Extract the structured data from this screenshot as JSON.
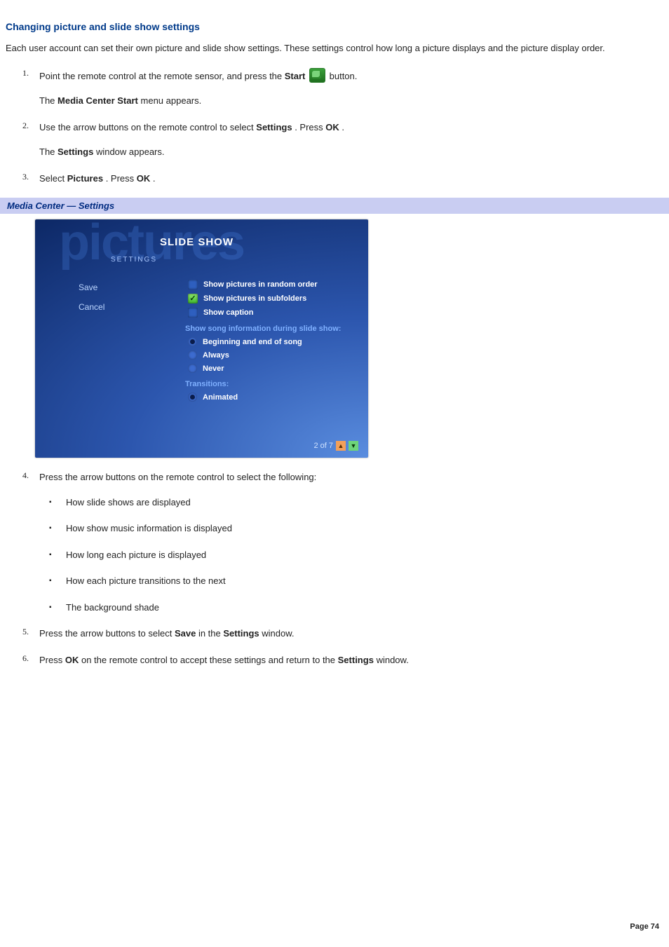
{
  "heading": "Changing picture and slide show settings",
  "intro": "Each user account can set their own picture and slide show settings. These settings control how long a picture displays and the picture display order.",
  "steps": {
    "s1": {
      "line1_a": "Point the remote control at the remote sensor, and press the ",
      "line1_bold": "Start",
      "line1_b": " button.",
      "line2_a": "The ",
      "line2_bold": "Media Center Start",
      "line2_b": " menu appears."
    },
    "s2": {
      "line1_a": "Use the arrow buttons on the remote control to select ",
      "line1_bold1": "Settings",
      "line1_mid": ". Press ",
      "line1_bold2": "OK",
      "line1_end": ".",
      "line2_a": "The ",
      "line2_bold": "Settings",
      "line2_b": " window appears."
    },
    "s3": {
      "a": "Select ",
      "bold": "Pictures",
      "mid": ". Press ",
      "bold2": "OK",
      "end": "."
    },
    "s4": {
      "intro": "Press the arrow buttons on the remote control to select the following:",
      "bullets": [
        "How slide shows are displayed",
        "How show music information is displayed",
        "How long each picture is displayed",
        "How each picture transitions to the next",
        "The background shade"
      ]
    },
    "s5": {
      "a": "Press the arrow buttons to select ",
      "b1": "Save",
      "b": " in the ",
      "b2": "Settings",
      "c": " window."
    },
    "s6": {
      "a": "Press ",
      "b1": "OK",
      "b": " on the remote control to accept these settings and return to the ",
      "b2": "Settings",
      "c": " window."
    }
  },
  "banner": "Media Center — Settings",
  "mc": {
    "bgword": "pictures",
    "subsettings": "SETTINGS",
    "title": "SLIDE SHOW",
    "left": {
      "save": "Save",
      "cancel": "Cancel"
    },
    "checks": [
      {
        "label": "Show pictures in random order",
        "checked": false
      },
      {
        "label": "Show pictures in subfolders",
        "checked": true
      },
      {
        "label": "Show caption",
        "checked": false
      }
    ],
    "group1_label": "Show song information during slide show:",
    "radios1": [
      {
        "label": "Beginning and end of song",
        "sel": true
      },
      {
        "label": "Always",
        "sel": false
      },
      {
        "label": "Never",
        "sel": false
      }
    ],
    "group2_label": "Transitions:",
    "radios2": [
      {
        "label": "Animated",
        "sel": true
      }
    ],
    "faded_next": "",
    "pager": "2 of 7"
  },
  "footer": "Page 74"
}
